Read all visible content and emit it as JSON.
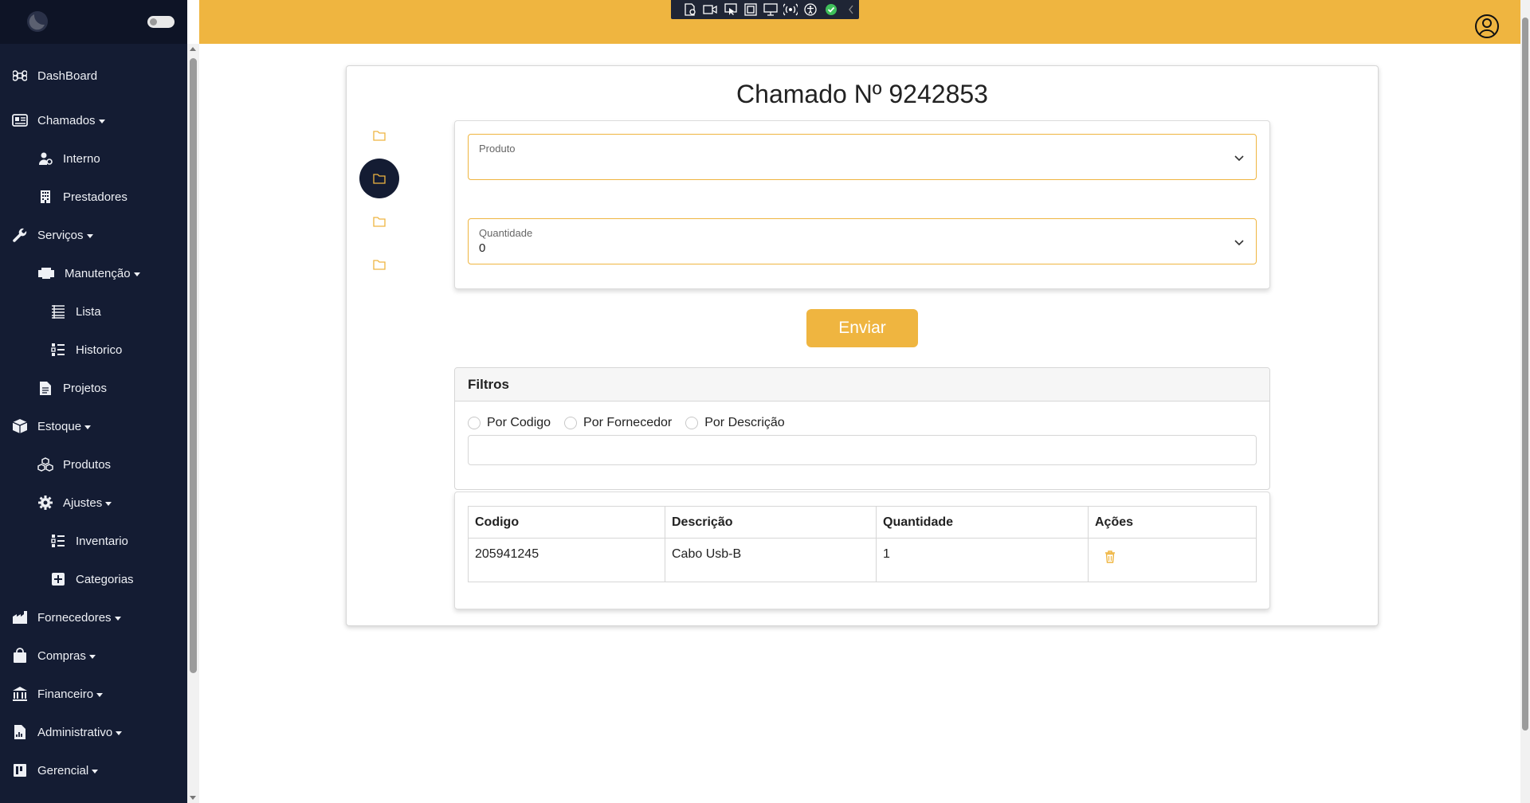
{
  "sidebar": {
    "items": [
      {
        "label": "DashBoard",
        "icon": "command-icon"
      },
      {
        "label": "Chamados",
        "icon": "tickets-icon"
      },
      {
        "label": "Interno",
        "icon": "user-gear-icon"
      },
      {
        "label": "Prestadores",
        "icon": "building-icon"
      },
      {
        "label": "Serviços",
        "icon": "wrench-icon"
      },
      {
        "label": "Manutenção",
        "icon": "printer-icon"
      },
      {
        "label": "Lista",
        "icon": "list-icon"
      },
      {
        "label": "Historico",
        "icon": "list-check-icon"
      },
      {
        "label": "Projetos",
        "icon": "document-icon"
      },
      {
        "label": "Estoque",
        "icon": "box-icon"
      },
      {
        "label": "Produtos",
        "icon": "boxes-icon"
      },
      {
        "label": "Ajustes",
        "icon": "gear-icon"
      },
      {
        "label": "Inventario",
        "icon": "list-check-icon"
      },
      {
        "label": "Categorias",
        "icon": "plus-square-icon"
      },
      {
        "label": "Fornecedores",
        "icon": "factory-icon"
      },
      {
        "label": "Compras",
        "icon": "shopping-bag-icon"
      },
      {
        "label": "Financeiro",
        "icon": "bank-icon"
      },
      {
        "label": "Administrativo",
        "icon": "report-icon"
      },
      {
        "label": "Gerencial",
        "icon": "kanban-icon"
      }
    ]
  },
  "page": {
    "title": "Chamado Nº 9242853"
  },
  "form": {
    "produto_label": "Produto",
    "produto_value": "",
    "quantidade_label": "Quantidade",
    "quantidade_value": "0",
    "submit_label": "Enviar"
  },
  "filters": {
    "title": "Filtros",
    "options": [
      "Por Codigo",
      "Por Fornecedor",
      "Por Descrição"
    ],
    "search_value": ""
  },
  "table": {
    "columns": [
      "Codigo",
      "Descrição",
      "Quantidade",
      "Ações"
    ],
    "rows": [
      {
        "codigo": "205941245",
        "descricao": "Cabo Usb-B",
        "quantidade": "1"
      }
    ]
  },
  "colors": {
    "accent": "#efb540",
    "sidebar_bg": "#141c33",
    "text": "#222222"
  }
}
